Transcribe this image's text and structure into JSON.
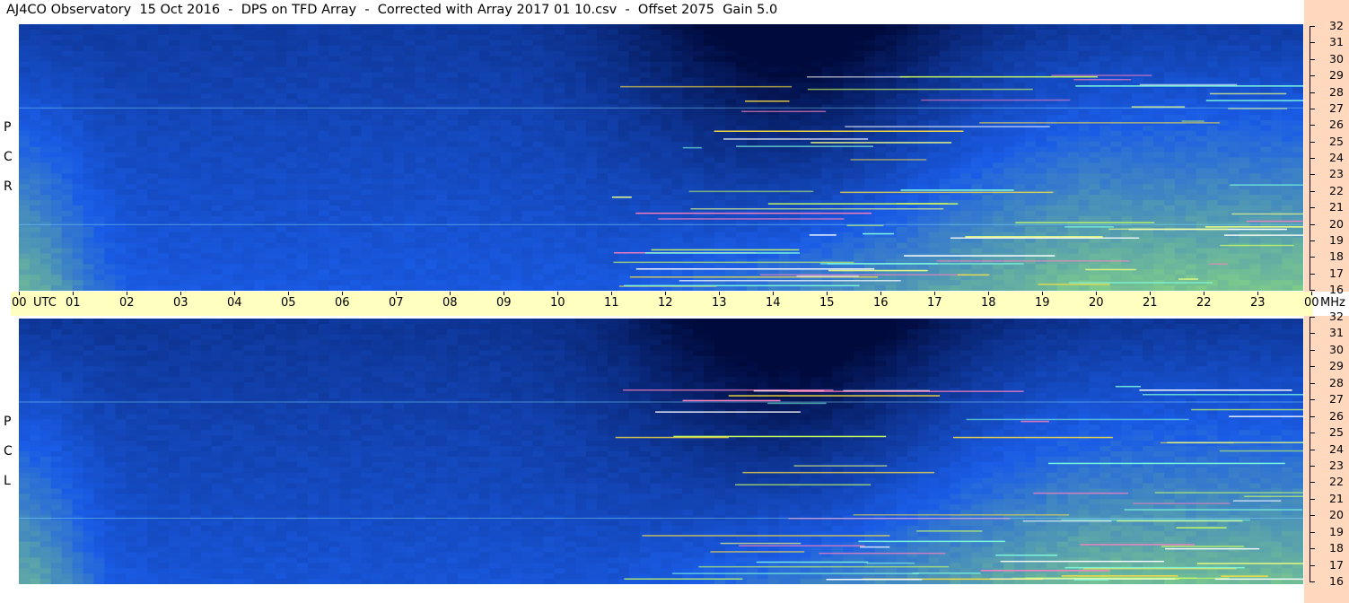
{
  "header": {
    "title": "AJ4CO Observatory  15 Oct 2016  -  DPS on TFD Array  -  Corrected with Array 2017 01 10.csv  -  Offset 2075  Gain 5.0"
  },
  "panels": {
    "top_label": [
      "R",
      "C",
      "P"
    ],
    "bottom_label": [
      "L",
      "C",
      "P"
    ]
  },
  "colors": {
    "background_frame": "#ffffff",
    "time_axis_bg": "#ffffc0",
    "freq_axis_bg": "#ffd8bd",
    "low_intensity": "#000a3c",
    "mid_intensity": "#1a5ce6",
    "high_intensity": "#9ff06c"
  },
  "chart_data": {
    "type": "heatmap",
    "x_unit": "UTC",
    "y_unit": "MHz",
    "x_ticks": [
      "00",
      "01",
      "02",
      "03",
      "04",
      "05",
      "06",
      "07",
      "08",
      "09",
      "10",
      "11",
      "12",
      "13",
      "14",
      "15",
      "16",
      "17",
      "18",
      "19",
      "20",
      "21",
      "22",
      "23",
      "00"
    ],
    "y_ticks": [
      "16",
      "17",
      "18",
      "19",
      "20",
      "21",
      "22",
      "23",
      "24",
      "25",
      "26",
      "27",
      "28",
      "29",
      "30",
      "31",
      "32"
    ],
    "xlim": [
      0,
      24
    ],
    "ylim": [
      16,
      32
    ],
    "panels": [
      "RCP",
      "LCP"
    ]
  }
}
